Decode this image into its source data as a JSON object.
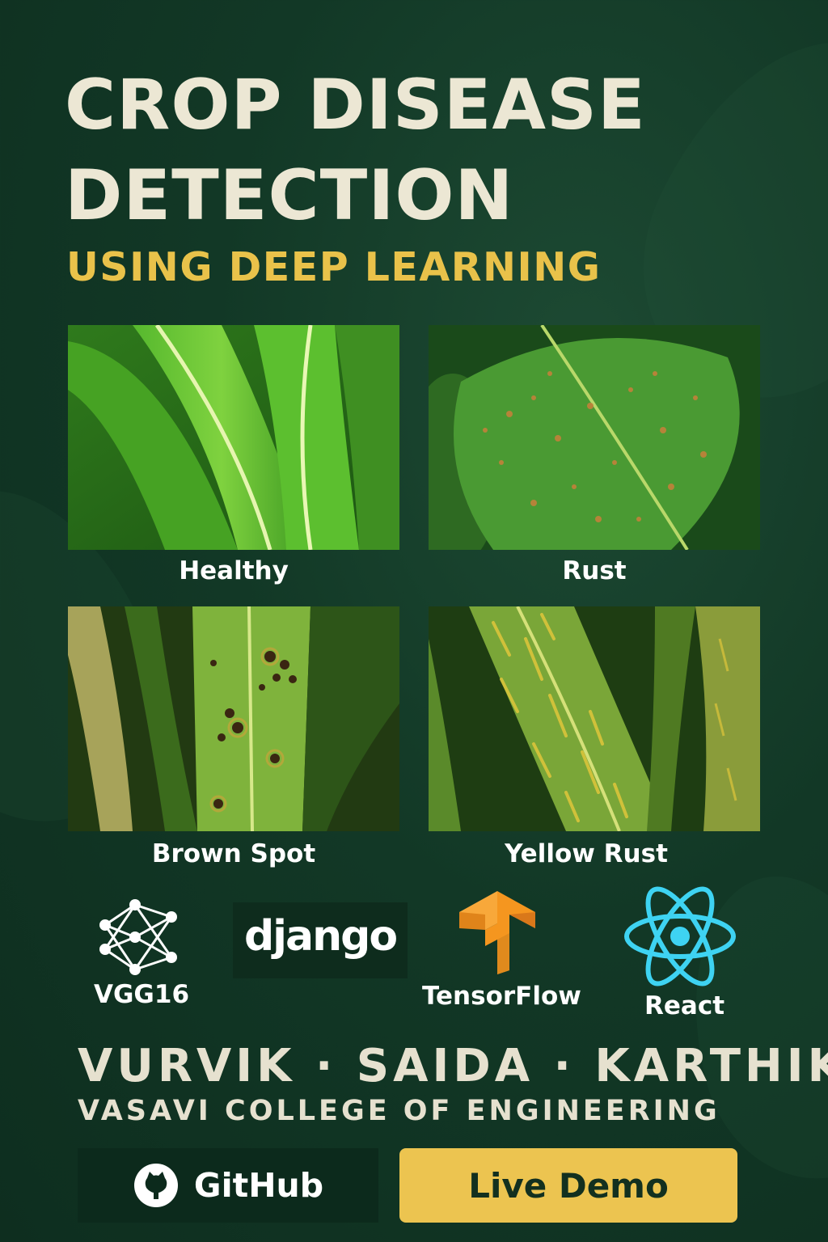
{
  "header": {
    "title_line1": "CROP DISEASE",
    "title_line2": "DETECTION",
    "subtitle": "USING DEEP LEARNING"
  },
  "gallery": [
    {
      "label": "Healthy",
      "icon": "healthy-leaf-image"
    },
    {
      "label": "Rust",
      "icon": "rust-leaf-image"
    },
    {
      "label": "Brown Spot",
      "icon": "brown-spot-leaf-image"
    },
    {
      "label": "Yellow Rust",
      "icon": "yellow-rust-leaf-image"
    }
  ],
  "tech_stack": [
    {
      "label": "VGG16",
      "icon": "neural-network-icon"
    },
    {
      "label": "django",
      "icon": "django-logo"
    },
    {
      "label": "TensorFlow",
      "icon": "tensorflow-logo",
      "color": "#f5961f"
    },
    {
      "label": "React",
      "icon": "react-logo",
      "color": "#3ed3f2"
    }
  ],
  "team": {
    "members": "VURVIK · SAIDA · KARTHIK",
    "college": "VASAVI COLLEGE OF ENGINEERING"
  },
  "actions": {
    "github_label": "GitHub",
    "live_demo_label": "Live Demo"
  },
  "colors": {
    "background": "#123826",
    "title": "#ece7d4",
    "subtitle": "#e9c24a",
    "live_demo_button": "#ecc450"
  }
}
